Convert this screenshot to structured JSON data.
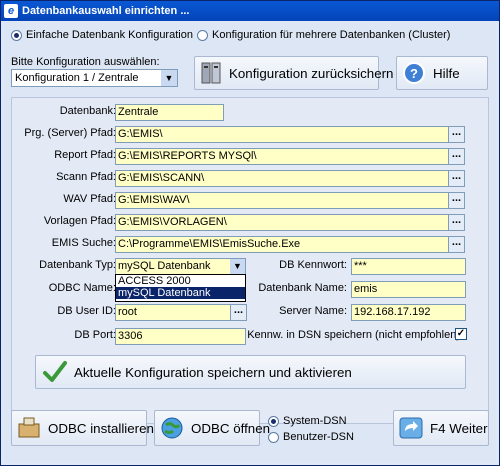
{
  "window": {
    "title": "Datenbankauswahl einrichten ...",
    "app_icon": "e"
  },
  "mode": {
    "single_label": "Einfache Datenbank Konfiguration",
    "cluster_label": "Konfiguration für mehrere Datenbanken (Cluster)",
    "selected": "single"
  },
  "config": {
    "select_label": "Bitte Konfiguration auswählen:",
    "selected": "Konfiguration 1 / Zentrale"
  },
  "buttons": {
    "reset": "Konfiguration zurücksichern",
    "help": "Hilfe",
    "save": "Aktuelle Konfiguration speichern und aktivieren",
    "odbc_install": "ODBC installieren",
    "odbc_open": "ODBC öffnen",
    "next": "F4 Weiter",
    "browse": "..."
  },
  "fields": {
    "datenbank": {
      "label": "Datenbank:",
      "value": "Zentrale"
    },
    "prg_pfad": {
      "label": "Prg. (Server) Pfad:",
      "value": "G:\\EMIS\\"
    },
    "report_pfad": {
      "label": "Report Pfad:",
      "value": "G:\\EMIS\\REPORTS MYSQl\\"
    },
    "scann_pfad": {
      "label": "Scann Pfad:",
      "value": "G:\\EMIS\\SCANN\\"
    },
    "wav_pfad": {
      "label": "WAV Pfad:",
      "value": "G:\\EMIS\\WAV\\"
    },
    "vorlagen_pfad": {
      "label": "Vorlagen Pfad:",
      "value": "G:\\EMIS\\VORLAGEN\\"
    },
    "emis_suche": {
      "label": "EMIS Suche:",
      "value": "C:\\Programme\\EMIS\\EmisSuche.Exe"
    },
    "db_typ": {
      "label": "Datenbank Typ:",
      "value": "mySQL Datenbank",
      "options": [
        "ACCESS 2000",
        "mySQL Datenbank"
      ]
    },
    "odbc_name": {
      "label": "ODBC Name:"
    },
    "db_user": {
      "label": "DB User ID:",
      "value": "root"
    },
    "db_port": {
      "label": "DB Port:",
      "value": "3306"
    },
    "db_kennwort": {
      "label": "DB Kennwort:",
      "value": "***"
    },
    "datenbank_name": {
      "label": "Datenbank Name:",
      "value": "emis"
    },
    "server_name": {
      "label": "Server Name:",
      "value": "192.168.17.192"
    },
    "kennw_dsn": {
      "label": "Kennw. in DSN speichern (nicht empfohlen)",
      "checked": true
    }
  },
  "dsn": {
    "system": "System-DSN",
    "user": "Benutzer-DSN",
    "selected": "system"
  }
}
